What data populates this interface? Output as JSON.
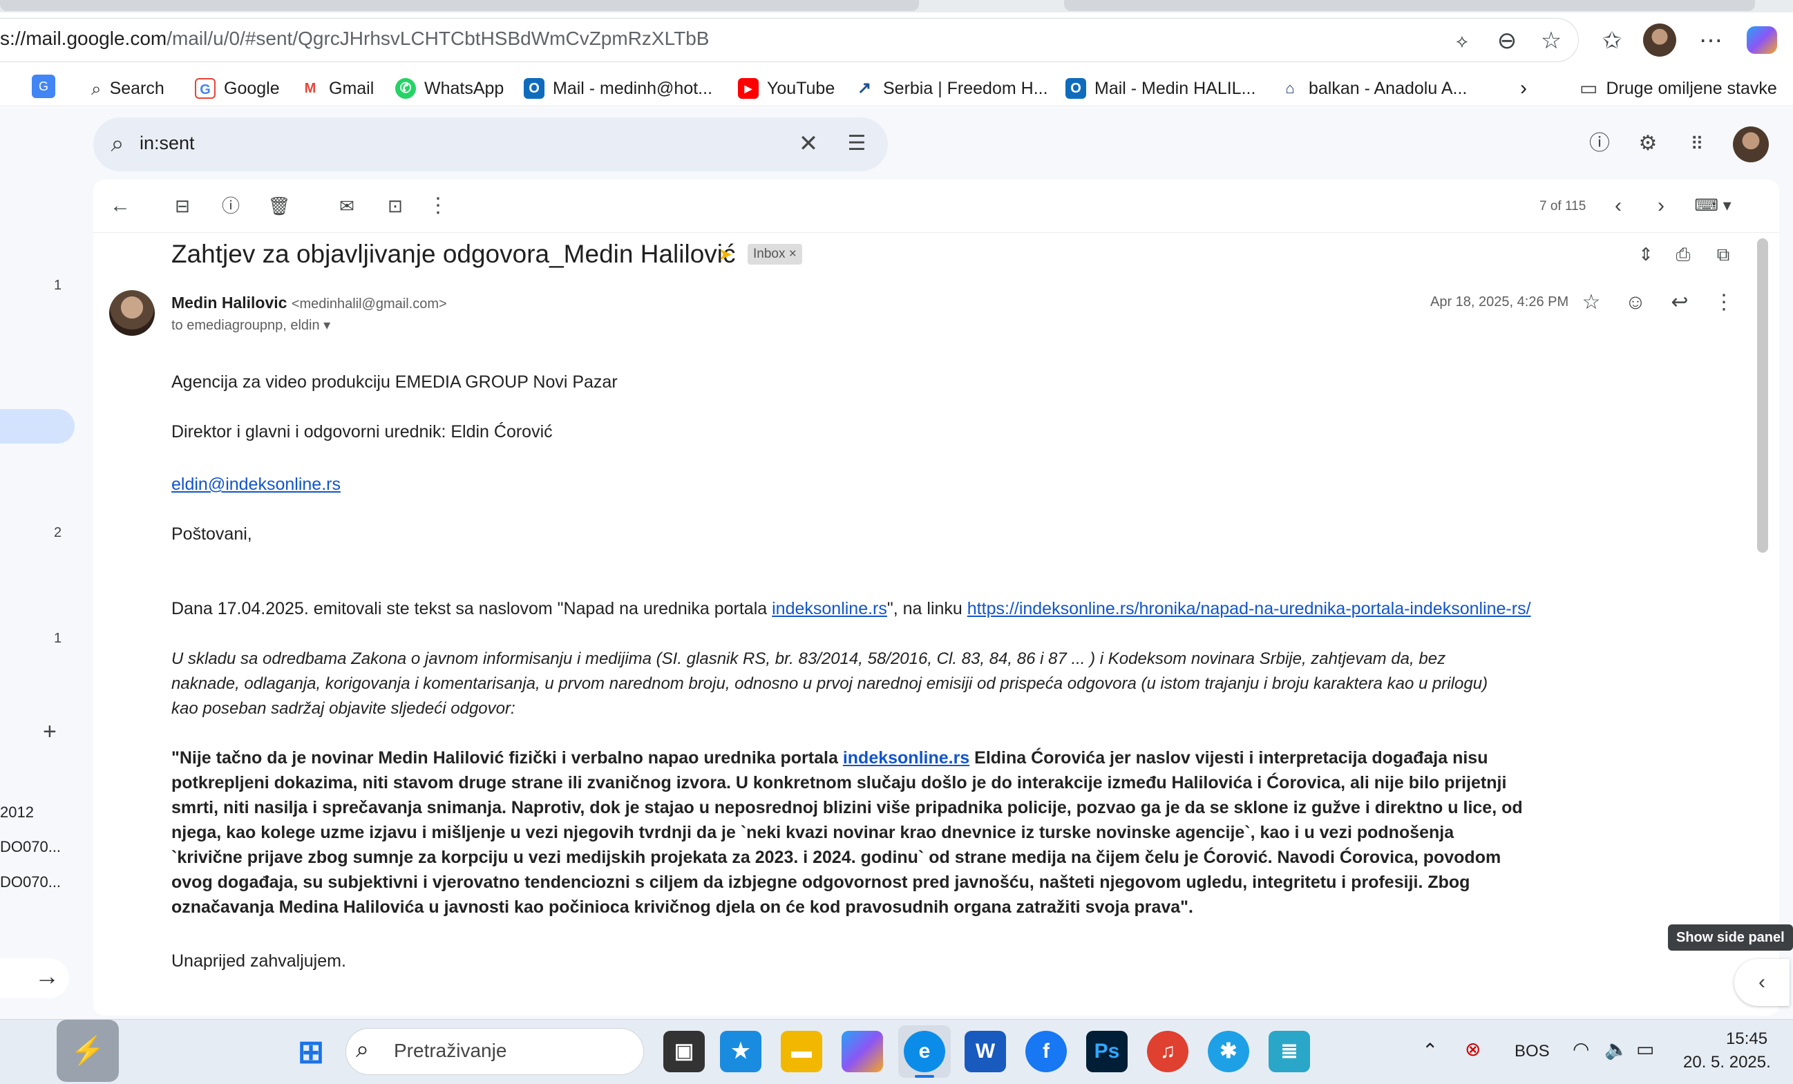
{
  "browser": {
    "url_host": "s://mail.google.com",
    "url_path": "/mail/u/0/#sent/QgrcJHrhsvLCHTCbtHSBdWmCvZpmRzXLTbB",
    "bookmarks": [
      {
        "label": "Search",
        "icon": "search-icon"
      },
      {
        "label": "Google",
        "icon": "google-icon"
      },
      {
        "label": "Gmail",
        "icon": "gmail-icon"
      },
      {
        "label": "WhatsApp",
        "icon": "whatsapp-icon"
      },
      {
        "label": "Mail - medinh@hot...",
        "icon": "outlook-icon"
      },
      {
        "label": "YouTube",
        "icon": "youtube-icon"
      },
      {
        "label": "Serbia | Freedom H...",
        "icon": "freedom-house-icon"
      },
      {
        "label": "Mail - Medin HALIL...",
        "icon": "outlook-icon"
      },
      {
        "label": "balkan - Anadolu A...",
        "icon": "anadolu-icon"
      }
    ],
    "other_bookmarks": "Druge omiljene stavke"
  },
  "gmail": {
    "search_value": "in:sent",
    "pager": "7 of 115",
    "leftnav": {
      "counts": [
        "1",
        "2",
        "1"
      ],
      "labels": [
        "2012",
        "DO070...",
        "DO070..."
      ]
    },
    "message": {
      "subject": "Zahtjev za objavljivanje odgovora_Medin Halilović",
      "tag": "Inbox",
      "sender_name": "Medin Halilovic",
      "sender_email": "<medinhalil@gmail.com>",
      "to": "to emediagroupnp, eldin",
      "date": "Apr 18, 2025, 4:26 PM",
      "body": {
        "p1": "Agencija za video produkciju EMEDIA GROUP Novi Pazar",
        "p2": "Direktor i glavni i odgovorni urednik: Eldin Ćorović",
        "email_link": "eldin@indeksonline.rs",
        "greeting": "Poštovani,",
        "p3a": "Dana 17.04.2025. emitovali ste tekst sa naslovom  \"Napad na urednika portala ",
        "p3link1": "indeksonline.rs",
        "p3b": "\", na linku ",
        "p3link2": "https://indeksonline.rs/hronika/napad-na-urednika-portala-indeksonline-rs/",
        "it1": " U skladu sa odredbama Zakona o javnom informisanju i medijima (SI. glasnik RS, br. 83/2014, 58/2016, Cl. 83, 84, 86 i 87 ... ) i Kodeksom novinara Srbije, zahtjevam da, bez",
        "it2": "naknade, odlaganja, korigovanja i komentarisanja, u prvom narednom broju, odnosno u prvoj narednoj  emisiji od prispeća odgovora (u istom trajanju i broju karaktera kao u prilogu)",
        "it3": "kao poseban sadržaj objavite sljedeći odgovor:",
        "b1a": "\"Nije tačno da je novinar Medin Halilović fizički i verbalno napao urednika portala ",
        "b1link": "indeksonline.rs",
        "b1b": " Eldina Ćorovića jer naslov vijesti i interpretacija događaja nisu",
        "b2": "potkrepljeni dokazima, niti stavom druge strane ili zvaničnog izvora. U konkretnom slučaju došlo je do interakcije između Halilovića i Ćorovica, ali nije bilo prijetnji",
        "b3": "smrti, niti nasilja i sprečavanja snimanja. Naprotiv, dok je stajao u neposrednoj blizini više pripadnika policije, pozvao ga je da se sklone iz gužve i direktno u lice, od",
        "b4": "njega, kao kolege uzme izjavu i mišljenje u vezi njegovih tvrdnji da je `neki kvazi novinar krao dnevnice iz turske novinske agencije`, kao i u vezi podnošenja",
        "b5": "`krivične prijave zbog sumnje za korpciju u vezi medijskih projekata za 2023. i 2024. godinu` od strane medija na čijem čelu je Ćorović. Navodi Ćorovica, povodom",
        "b6": "ovog događaja, su subjektivni i vjerovatno tendenciozni s ciljem da izbjegne odgovornost pred javnošću, našteti njegovom ugledu, integritetu i profesiji. Zbog",
        "b7": "označavanja Medina Halilovića u javnosti kao počinioca krivičnog djela on će kod pravosudnih organa zatražiti svoja prava\".",
        "closing": "Unaprijed zahvaljujem."
      }
    },
    "tooltip": "Show side panel"
  },
  "taskbar": {
    "search_placeholder": "Pretraživanje",
    "lang": "BOS",
    "time": "15:45",
    "date": "20. 5. 2025."
  }
}
